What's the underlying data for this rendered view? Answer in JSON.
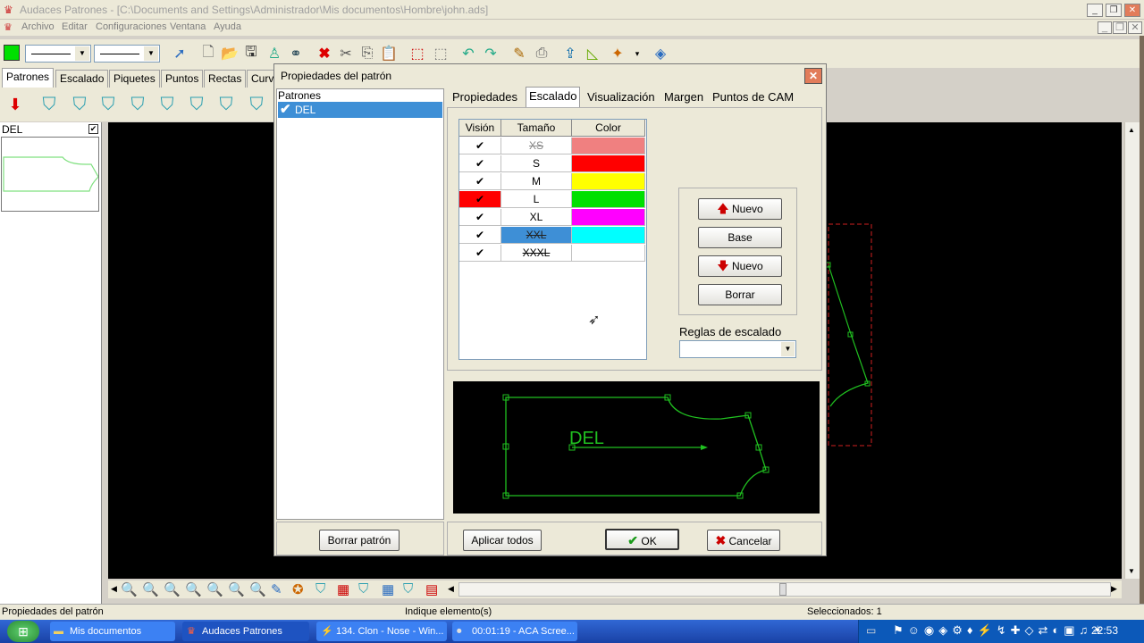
{
  "app": {
    "title": "Audaces Patrones - [C:\\Documents and Settings\\Administrador\\Mis documentos\\Hombre\\john.ads]",
    "menu": [
      "Archivo",
      "Editar",
      "Configuraciones",
      "Ventana",
      "Ayuda"
    ]
  },
  "tabs": [
    "Patrones",
    "Escalado",
    "Piquetes",
    "Puntos",
    "Rectas",
    "Curv"
  ],
  "thumb": {
    "label": "DEL"
  },
  "dialog": {
    "title": "Propiedades del patrón",
    "close": "✕",
    "patterns_label": "Patrones",
    "pattern_item": "DEL",
    "tabs": [
      "Propiedades",
      "Escalado",
      "Visualización",
      "Margen",
      "Puntos de CAM"
    ],
    "grid": {
      "headers": [
        "Visión",
        "Tamaño",
        "Color"
      ],
      "rows": [
        {
          "check": "✔",
          "size": "XS",
          "color": "#f08080"
        },
        {
          "check": "✔",
          "size": "S",
          "color": "#ff0000"
        },
        {
          "check": "✔",
          "size": "M",
          "color": "#ffff00"
        },
        {
          "check": "✔",
          "size": "L",
          "color": "#00e000"
        },
        {
          "check": "✔",
          "size": "XL",
          "color": "#ff00ff"
        },
        {
          "check": "✔",
          "size": "XXL",
          "color": "#00ffff"
        },
        {
          "check": "✔",
          "size": "XXXL",
          "color": "#ffffff"
        }
      ]
    },
    "buttons": {
      "nuevo_up": "Nuevo",
      "base": "Base",
      "nuevo_down": "Nuevo",
      "borrar": "Borrar",
      "borrar_patron": "Borrar patrón",
      "aplicar_todos": "Aplicar todos",
      "ok": "OK",
      "cancelar": "Cancelar"
    },
    "rules_label": "Reglas de escalado",
    "preview_label": "DEL"
  },
  "status": {
    "left": "Propiedades del patrón",
    "middle": "Indique elemento(s)",
    "right": "Seleccionados: 1"
  },
  "taskbar": {
    "items": [
      "Mis documentos",
      "Audaces Patrones",
      "134. Clon - Nose - Win...",
      "00:01:19 - ACA Scree..."
    ],
    "clock": "22:53"
  }
}
